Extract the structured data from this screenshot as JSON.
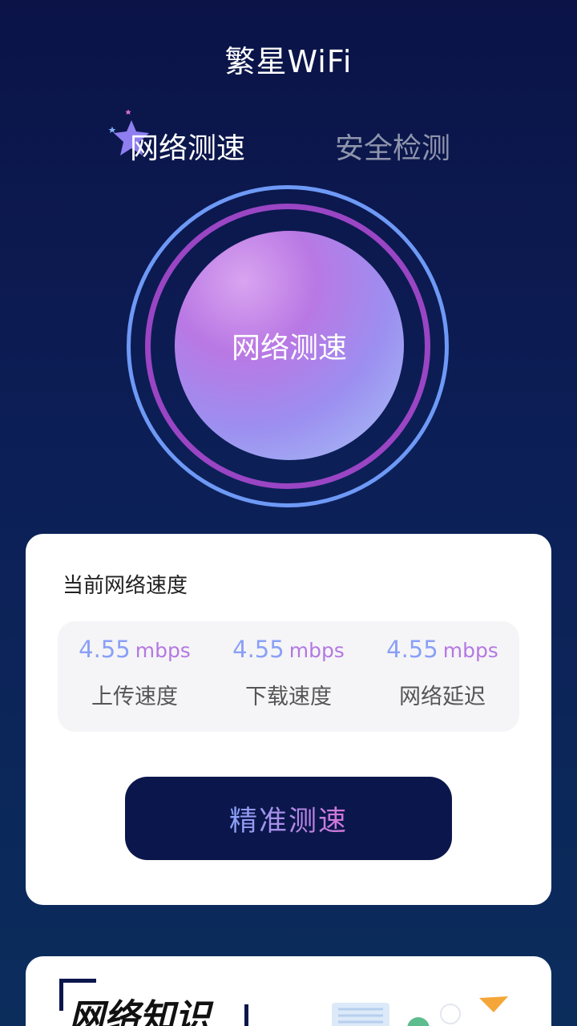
{
  "app": {
    "title": "繁星WiFi"
  },
  "tabs": [
    {
      "label": "网络测速",
      "active": true
    },
    {
      "label": "安全检测",
      "active": false
    }
  ],
  "gauge": {
    "label": "网络测速"
  },
  "speed_card": {
    "title": "当前网络速度",
    "stats": [
      {
        "value": "4.55",
        "unit": "mbps",
        "label": "上传速度"
      },
      {
        "value": "4.55",
        "unit": "mbps",
        "label": "下载速度"
      },
      {
        "value": "4.55",
        "unit": "mbps",
        "label": "网络延迟"
      }
    ],
    "button_label": "精准测速"
  },
  "knowledge_card": {
    "title": "网络知识"
  },
  "colors": {
    "background_top": "#0b1347",
    "accent_blue": "#6e99f6",
    "accent_purple": "#9a45c4",
    "button_bg": "#0b174c"
  },
  "icons": {
    "tab_badge": "star-icon"
  }
}
